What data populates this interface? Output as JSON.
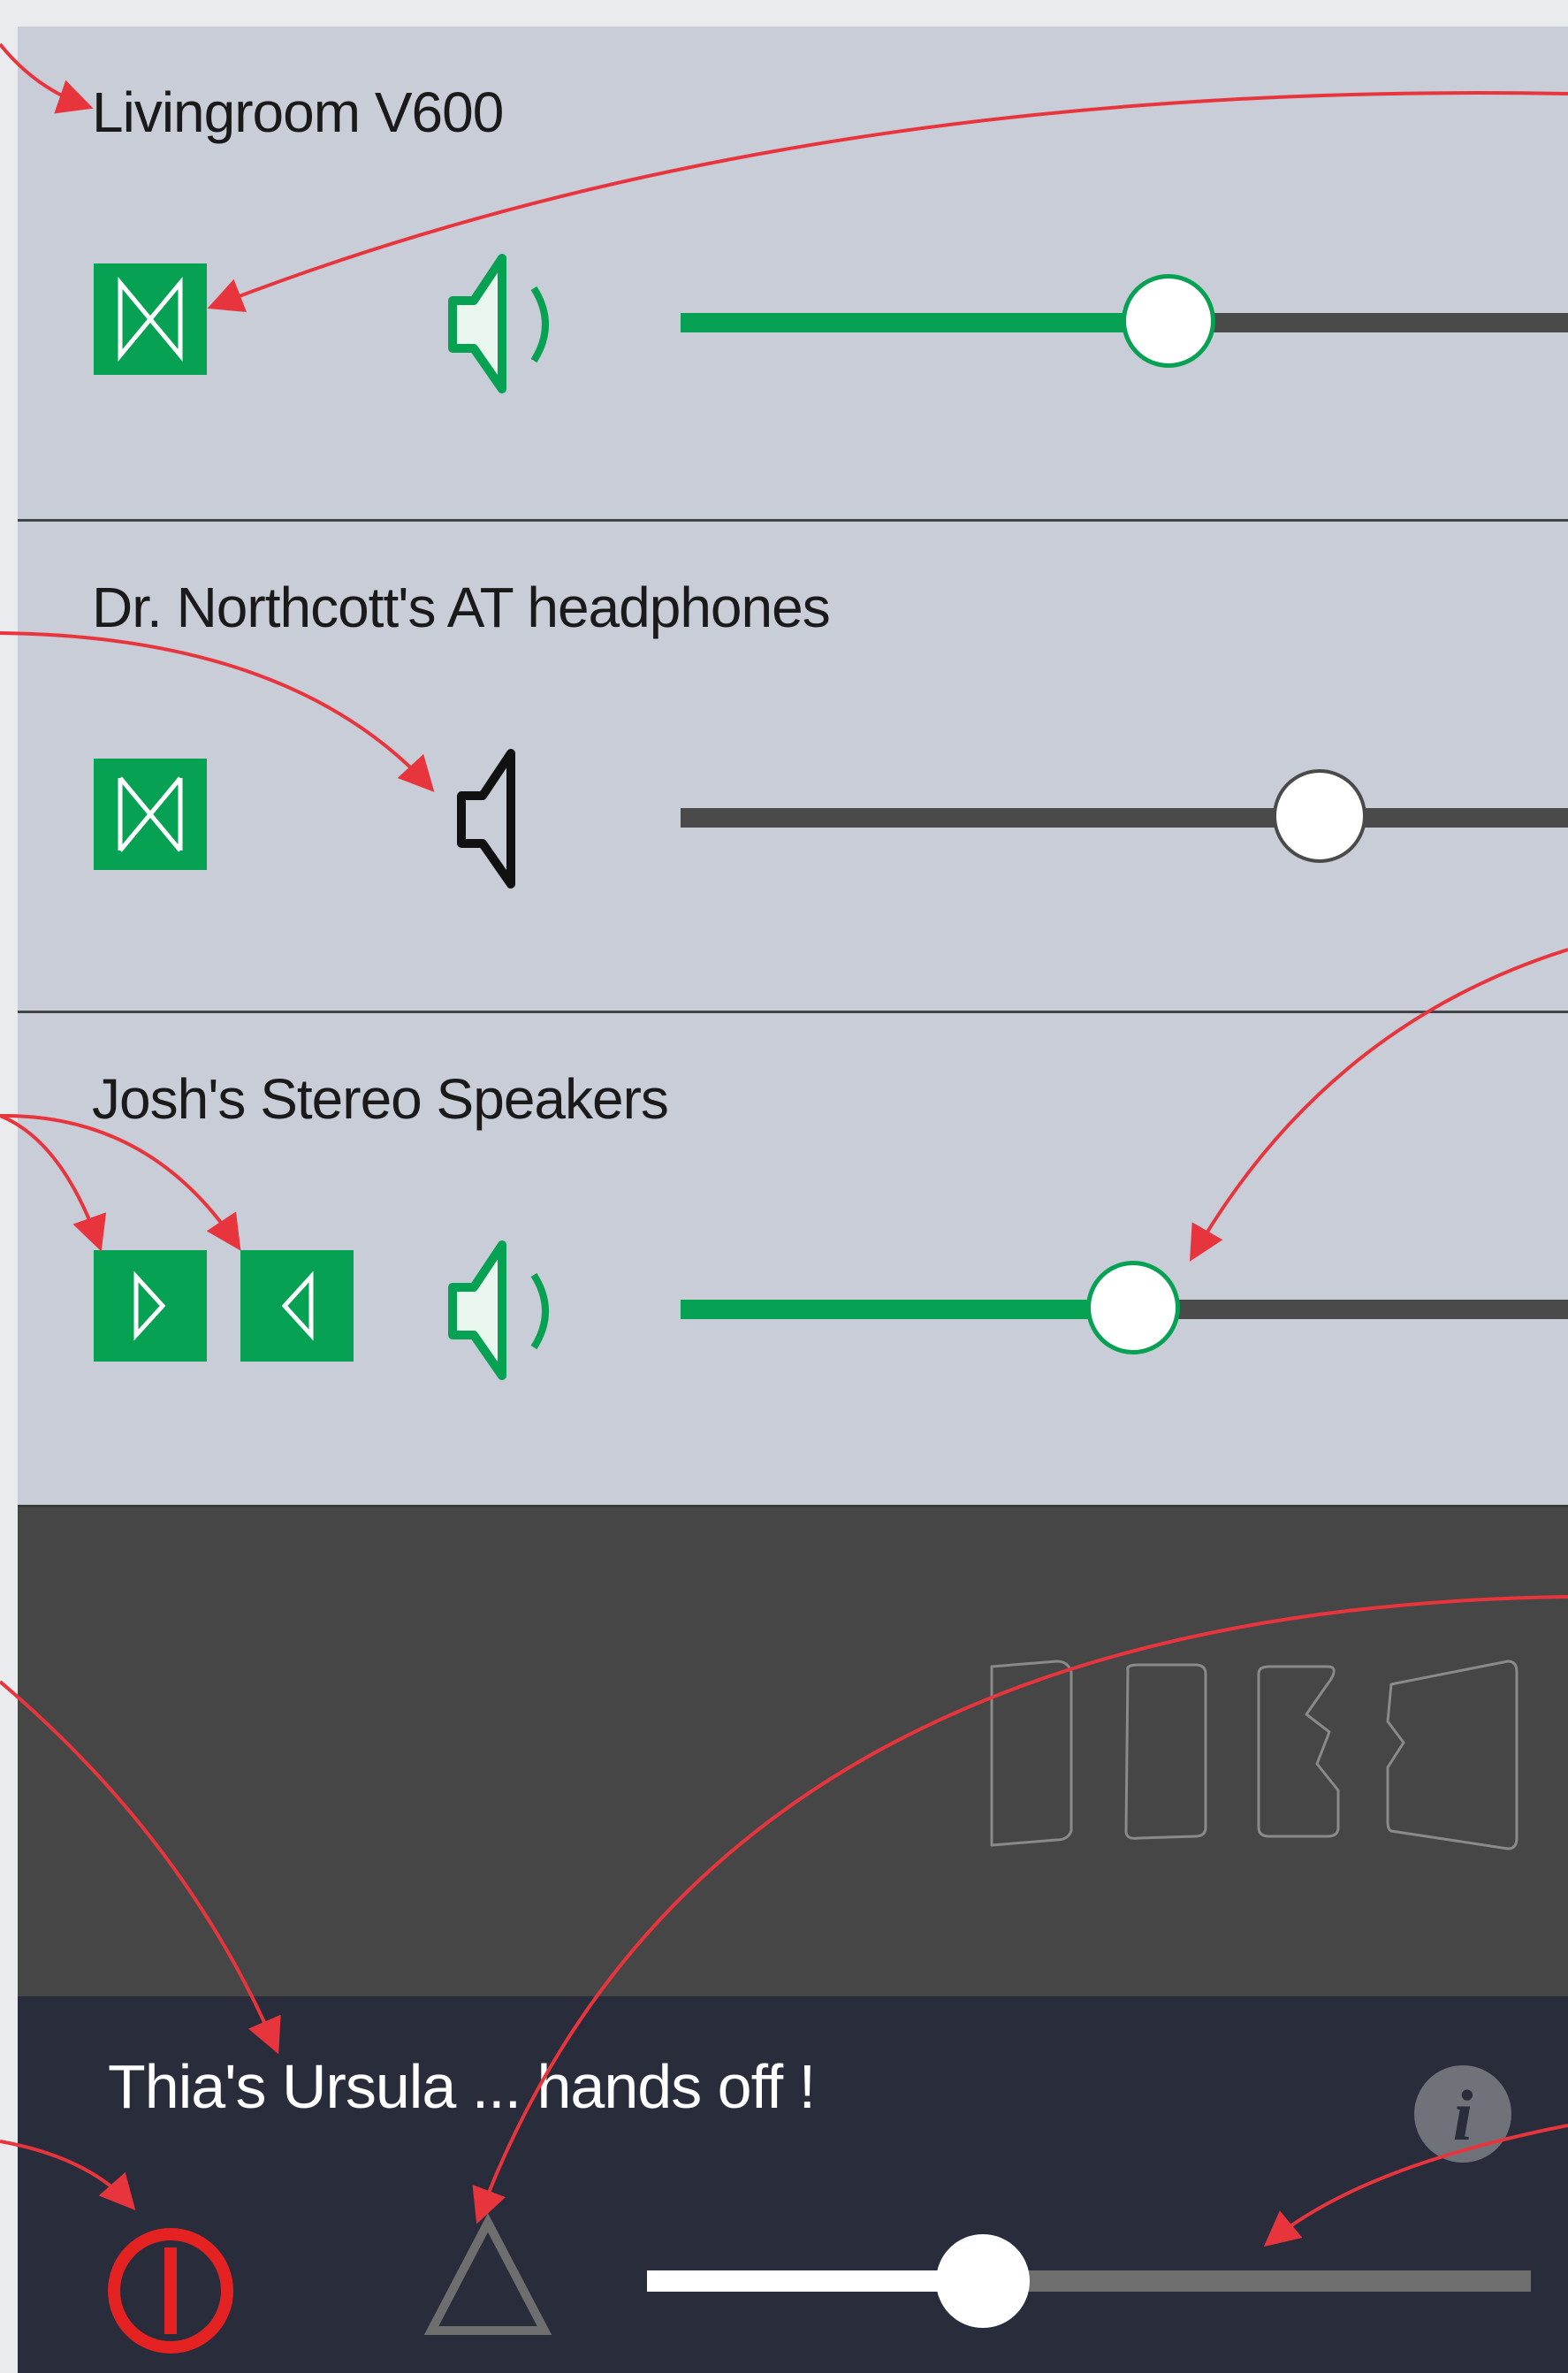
{
  "devices": [
    {
      "name": "Livingroom V600",
      "channel_mode": "stereo",
      "volume_state": "on",
      "volume_level": 0.55
    },
    {
      "name": "Dr. Northcott's AT headphones",
      "channel_mode": "stereo",
      "volume_state": "muted",
      "volume_level": 0.72
    },
    {
      "name": "Josh's Stereo Speakers",
      "channel_mode": "left-right split",
      "volume_state": "on",
      "volume_level": 0.51
    }
  ],
  "icons": {
    "stereo": "bowtie-stereo-icon",
    "left": "left-channel-icon",
    "right": "right-channel-icon",
    "speaker_on": "speaker-on-icon",
    "speaker_muted": "speaker-muted-icon",
    "logo": "group-logo-icon",
    "power": "power-icon",
    "play": "play-triangle-icon",
    "info": "info-icon"
  },
  "master": {
    "name": "Thia's Ursula ... hands off !",
    "volume_level": 0.38
  },
  "colors": {
    "panel": "#c9cdd7",
    "green": "#06a152",
    "divider": "#434548",
    "inactive_panel": "#464646",
    "master_bar": "#282c3b",
    "power_red": "#e52222",
    "annotation_red": "#e8353d"
  }
}
